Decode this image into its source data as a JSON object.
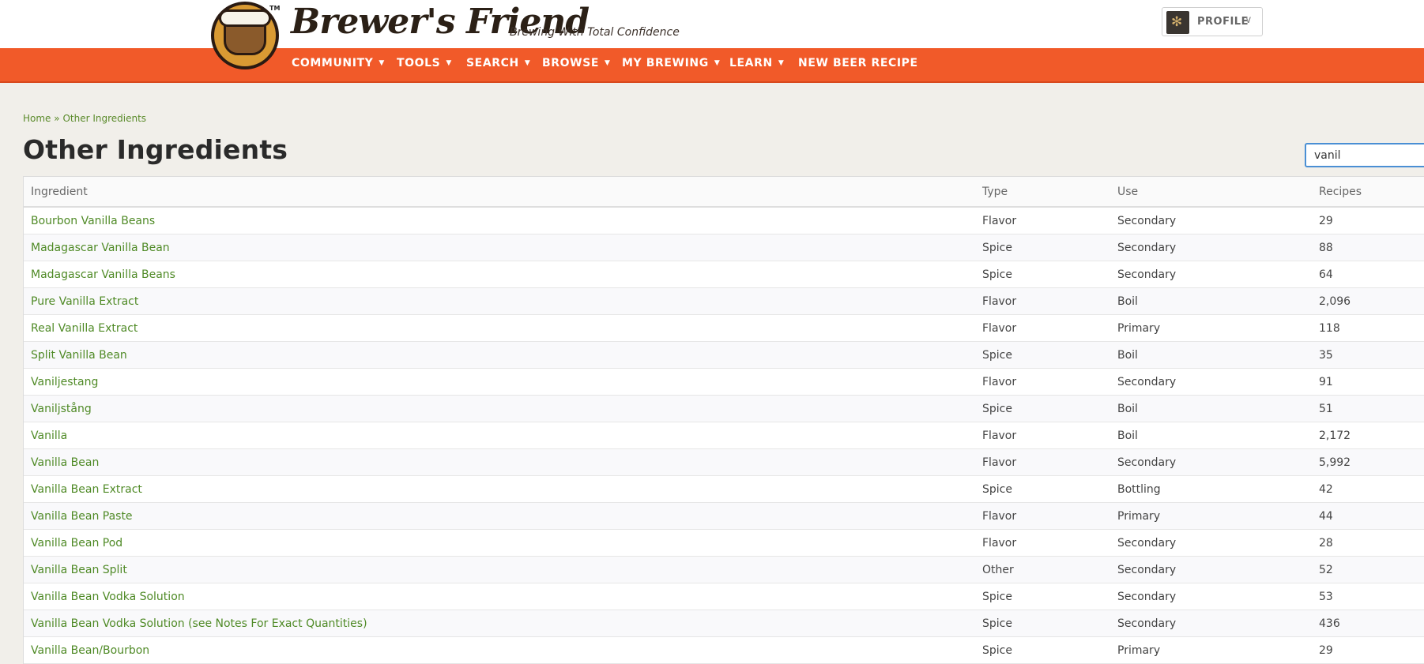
{
  "brand": {
    "name": "Brewer's Friend",
    "tagline": "Brewing With Total Confidence",
    "tm": "TM"
  },
  "profile": {
    "label": "PROFILE",
    "chevron": "∨"
  },
  "nav": {
    "items": [
      {
        "label": "COMMUNITY",
        "dropdown": true
      },
      {
        "label": "TOOLS",
        "dropdown": true
      },
      {
        "label": "SEARCH",
        "dropdown": true
      },
      {
        "label": "BROWSE",
        "dropdown": true
      },
      {
        "label": "MY BREWING",
        "dropdown": true
      },
      {
        "label": "LEARN",
        "dropdown": true
      },
      {
        "label": "NEW BEER RECIPE",
        "dropdown": false
      }
    ]
  },
  "breadcrumb": {
    "home": "Home",
    "separator": "»",
    "current": "Other Ingredients"
  },
  "page": {
    "title": "Other Ingredients"
  },
  "search": {
    "value": "vanil"
  },
  "table": {
    "headers": [
      "Ingredient",
      "Type",
      "Use",
      "Recipes"
    ],
    "rows": [
      [
        "Bourbon Vanilla Beans",
        "Flavor",
        "Secondary",
        "29"
      ],
      [
        "Madagascar Vanilla Bean",
        "Spice",
        "Secondary",
        "88"
      ],
      [
        "Madagascar Vanilla Beans",
        "Spice",
        "Secondary",
        "64"
      ],
      [
        "Pure Vanilla Extract",
        "Flavor",
        "Boil",
        "2,096"
      ],
      [
        "Real Vanilla Extract",
        "Flavor",
        "Primary",
        "118"
      ],
      [
        "Split Vanilla Bean",
        "Spice",
        "Boil",
        "35"
      ],
      [
        "Vaniljestang",
        "Flavor",
        "Secondary",
        "91"
      ],
      [
        "Vaniljstång",
        "Spice",
        "Boil",
        "51"
      ],
      [
        "Vanilla",
        "Flavor",
        "Boil",
        "2,172"
      ],
      [
        "Vanilla Bean",
        "Flavor",
        "Secondary",
        "5,992"
      ],
      [
        "Vanilla Bean Extract",
        "Spice",
        "Bottling",
        "42"
      ],
      [
        "Vanilla Bean Paste",
        "Flavor",
        "Primary",
        "44"
      ],
      [
        "Vanilla Bean Pod",
        "Flavor",
        "Secondary",
        "28"
      ],
      [
        "Vanilla Bean Split",
        "Other",
        "Secondary",
        "52"
      ],
      [
        "Vanilla Bean Vodka Solution",
        "Spice",
        "Secondary",
        "53"
      ],
      [
        "Vanilla Bean Vodka Solution (see Notes For Exact Quantities)",
        "Spice",
        "Secondary",
        "436"
      ],
      [
        "Vanilla Bean/Bourbon",
        "Spice",
        "Primary",
        "29"
      ]
    ]
  },
  "colors": {
    "nav": "#f15a29",
    "link": "#4f8a26",
    "background": "#f1efea"
  }
}
